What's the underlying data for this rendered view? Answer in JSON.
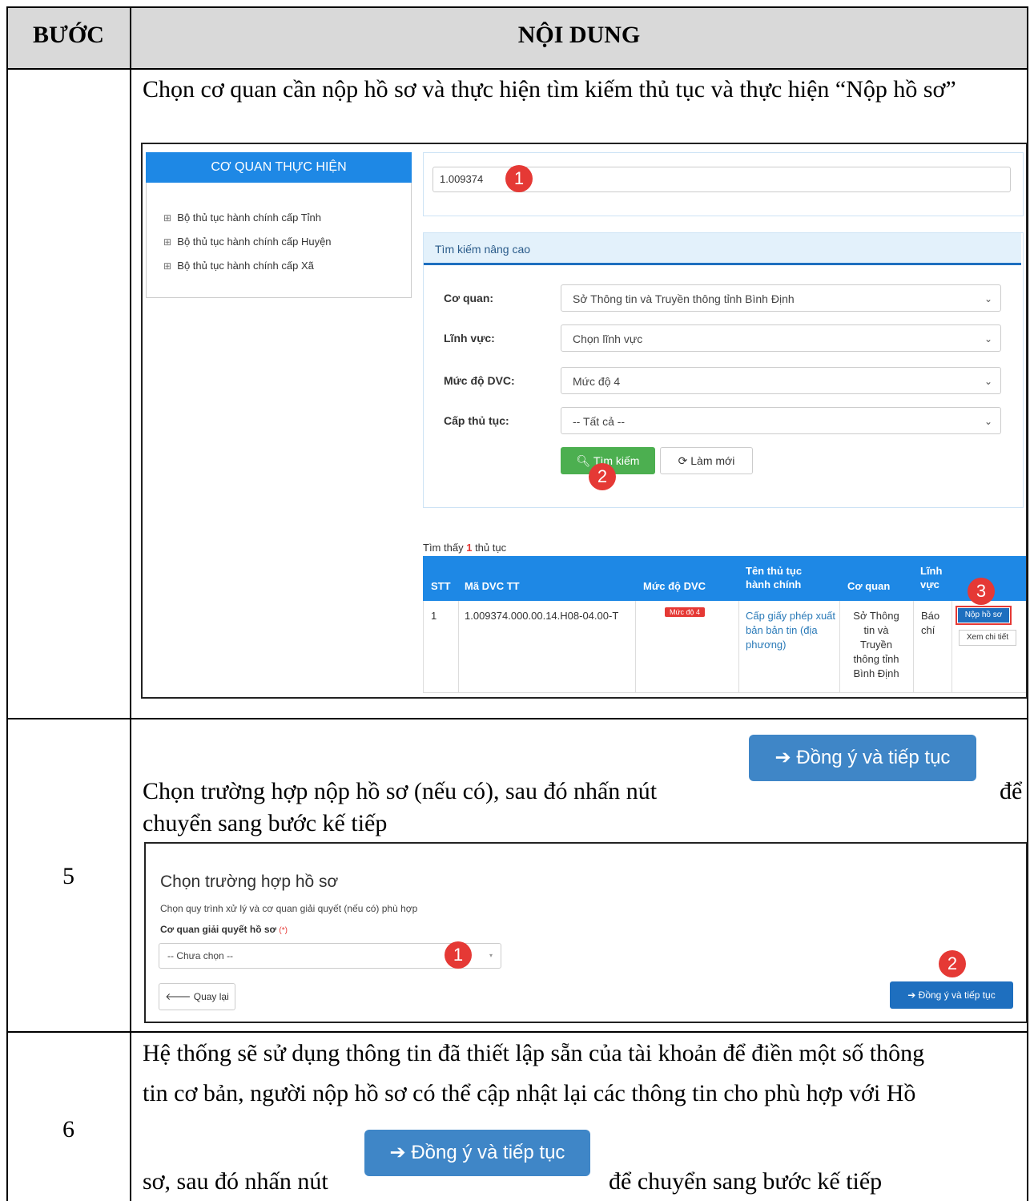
{
  "table": {
    "col_step": "BƯỚC",
    "col_content": "NỘI DUNG"
  },
  "row1": {
    "text": "Chọn cơ quan cần nộp hồ sơ và thực hiện tìm kiếm thủ tục và thực hiện “Nộp hồ sơ”",
    "sidebar_title": "CƠ QUAN THỰC HIỆN",
    "tree": [
      "Bộ thủ tục hành chính cấp Tỉnh",
      "Bộ thủ tục hành chính cấp Huyện",
      "Bộ thủ tục hành chính cấp Xã"
    ],
    "search_value": "1.009374",
    "advanced_title": "Tìm kiếm nâng cao",
    "fields": [
      {
        "label": "Cơ quan:",
        "value": "Sở Thông tin và Truyền thông tỉnh Bình Định"
      },
      {
        "label": "Lĩnh vực:",
        "value": "Chọn lĩnh vực"
      },
      {
        "label": "Mức độ DVC:",
        "value": "Mức độ 4"
      },
      {
        "label": "Cấp thủ tục:",
        "value": "-- Tất cả --"
      }
    ],
    "search_btn": "Tìm kiếm",
    "reset_btn": "Làm mới",
    "found_prefix": "Tìm thấy",
    "found_count": "1",
    "found_suffix": "thủ tục",
    "headers": [
      "STT",
      "Mã DVC TT",
      "Mức độ DVC",
      "Tên thủ tục hành chính",
      "Cơ quan",
      "Lĩnh vực"
    ],
    "row": {
      "stt": "1",
      "code": "1.009374.000.00.14.H08-04.00-T",
      "level": "Mức độ 4",
      "name": "Cấp giấy phép xuất bản bản tin (địa phương)",
      "agency": "Sở Thông tin và Truyền thông tỉnh Bình Định",
      "field": "Báo chí",
      "submit": "Nộp hồ sơ",
      "detail": "Xem chi tiết"
    },
    "markers": [
      "1",
      "2",
      "3"
    ]
  },
  "row5": {
    "step": "5",
    "text_a": "Chọn trường hợp nộp hồ sơ (nếu có), sau đó nhấn nút",
    "text_b": "để",
    "text_c": "chuyển sang bước kế tiếp",
    "button": "Đồng ý và tiếp tục",
    "panel_title": "Chọn trường hợp hồ sơ",
    "panel_sub": "Chọn quy trình xử lý và cơ quan giải quyết (nếu có) phù hợp",
    "field_label": "Cơ quan giải quyết hồ sơ",
    "required": "(*)",
    "select_value": "-- Chưa chọn --",
    "back_btn": "Quay lại",
    "next_btn": "Đồng ý và tiếp tục",
    "markers": [
      "1",
      "2"
    ]
  },
  "row6": {
    "step": "6",
    "line1": "Hệ thống sẽ sử dụng thông tin đã thiết lập sẵn của tài khoản để điền một số thông",
    "line2": "tin cơ bản, người nộp hồ sơ có thể cập nhật lại các thông tin cho phù hợp với Hồ",
    "line3a": "sơ, sau đó nhấn nút",
    "line3b": "để chuyển sang bước kế tiếp",
    "button": "Đồng ý và tiếp tục"
  },
  "colors": {
    "header_bg": "#d9d9d9",
    "accent_blue": "#1e88e5",
    "green": "#4caf50",
    "red": "#e53935"
  }
}
